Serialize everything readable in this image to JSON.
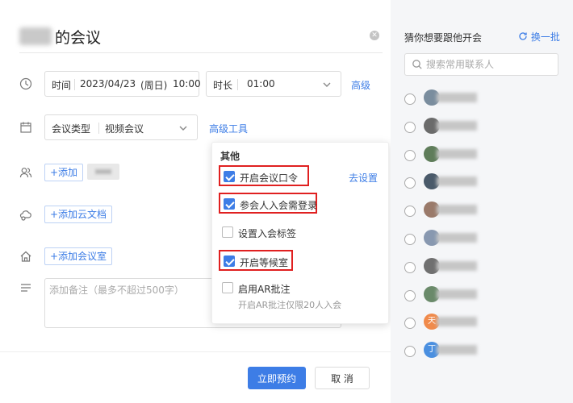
{
  "title": {
    "text": "的会议"
  },
  "time_row": {
    "label": "时间",
    "date": "2023/04/23",
    "weekday": "(周日)",
    "time": "10:00",
    "duration_label": "时长",
    "duration_value": "01:00",
    "advanced_link": "高级"
  },
  "type_row": {
    "label": "会议类型",
    "value": "视频会议",
    "tools_link": "高级工具"
  },
  "participants": {
    "add_label": "+添加"
  },
  "docs": {
    "add_label": "+添加云文档"
  },
  "room": {
    "add_label": "+添加会议室"
  },
  "notes": {
    "placeholder": "添加备注（最多不超过500字）"
  },
  "dropdown": {
    "heading": "其他",
    "options": [
      {
        "label": "开启会议口令",
        "checked": true
      },
      {
        "label": "参会人入会需登录",
        "checked": true
      },
      {
        "label": "设置入会标签",
        "checked": false
      },
      {
        "label": "开启等候室",
        "checked": true
      },
      {
        "label": "启用AR批注",
        "checked": false
      }
    ],
    "goto_settings": "去设置",
    "ar_note": "开启AR批注仅限20人入会"
  },
  "footer": {
    "confirm": "立即预约",
    "cancel": "取 消"
  },
  "suggest": {
    "title": "猜你想要跟他开会",
    "refresh": "换一批",
    "search_placeholder": "搜索常用联系人",
    "contacts": [
      {
        "avatar_text": ""
      },
      {
        "avatar_text": ""
      },
      {
        "avatar_text": ""
      },
      {
        "avatar_text": ""
      },
      {
        "avatar_text": ""
      },
      {
        "avatar_text": ""
      },
      {
        "avatar_text": ""
      },
      {
        "avatar_text": ""
      },
      {
        "avatar_text": "天"
      },
      {
        "avatar_text": "丁"
      }
    ]
  },
  "colors": {
    "accent": "#3d7de6",
    "highlight": "#e02020"
  }
}
